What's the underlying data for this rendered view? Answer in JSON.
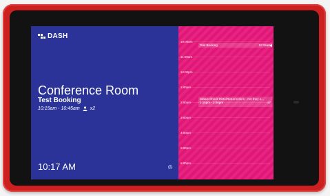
{
  "brand": {
    "logo_text": "DASH"
  },
  "room": {
    "name": "Conference Room",
    "booking_title": "Test Booking",
    "booking_time": "10:15am - 10:45am",
    "attendees": "x2"
  },
  "clock": {
    "time": "10:17 AM"
  },
  "schedule": {
    "hours": [
      "10:00am",
      "11:00am",
      "12:00pm",
      "1:00pm",
      "2:00pm",
      "3:00pm",
      "4:00pm",
      "5:00pm",
      "6:00pm"
    ],
    "events": [
      {
        "title": "Test Booking",
        "time": "10:15am"
      },
      {
        "title": "Status Check RMA/Returns Bins - Are they e...",
        "time": "1:15pm - 2:00pm",
        "attendees": "x7"
      }
    ]
  },
  "colors": {
    "bezel": "#cc2020",
    "left_panel": "#2b3398",
    "right_panel": "#e6187a"
  }
}
